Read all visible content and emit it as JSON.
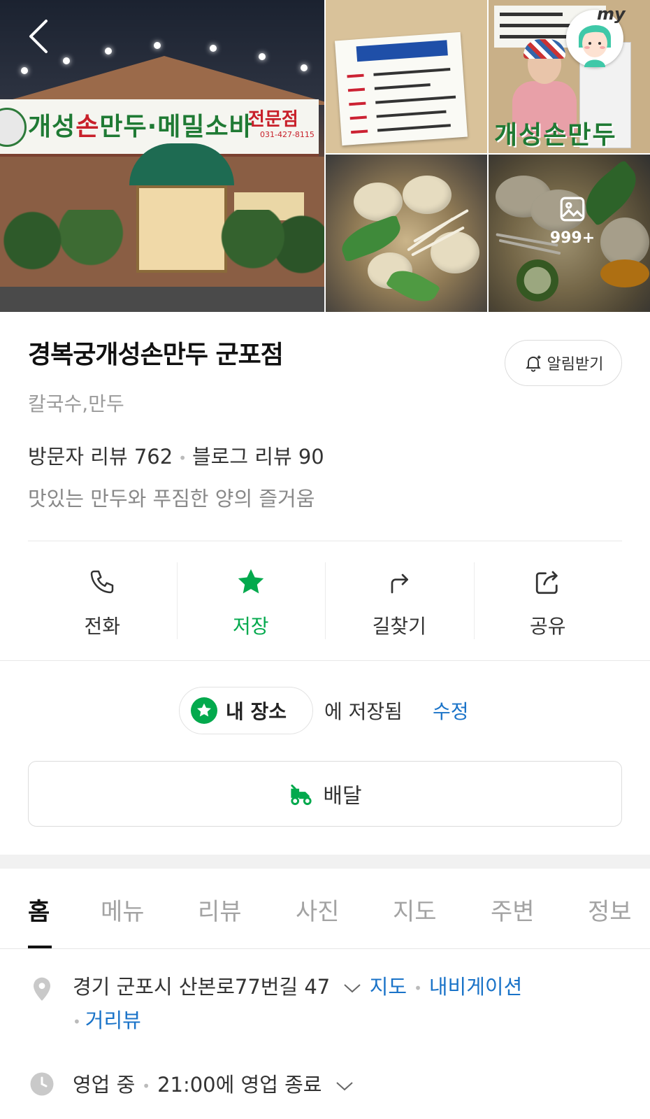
{
  "gallery": {
    "main_sign_text_green_1": "개성",
    "main_sign_text_red_1": "손",
    "main_sign_text_green_2": "만두·메밀소바",
    "main_sign_sub": "전문점",
    "main_sign_phone": "031-427-8115",
    "cook_photo_sign": "개성손만두",
    "photo_count": "999+",
    "my_badge": "my"
  },
  "place": {
    "title": "경복궁개성손만두 군포점",
    "alarm_label": "알림받기",
    "category": "칼국수,만두",
    "visitor_review_label": "방문자 리뷰 762",
    "blog_review_label": "블로그 리뷰 90",
    "description": "맛있는 만두와 푸짐한 양의 즐거움"
  },
  "actions": [
    {
      "label": "전화",
      "icon": "phone-icon"
    },
    {
      "label": "저장",
      "icon": "star-icon"
    },
    {
      "label": "길찾기",
      "icon": "directions-icon"
    },
    {
      "label": "공유",
      "icon": "share-icon"
    }
  ],
  "saved": {
    "list_name": "내 장소",
    "saved_text": "에 저장됨",
    "edit_label": "수정"
  },
  "delivery": {
    "label": "배달"
  },
  "tabs": [
    "홈",
    "메뉴",
    "리뷰",
    "사진",
    "지도",
    "주변",
    "정보"
  ],
  "address": {
    "text": "경기 군포시 산본로77번길 47",
    "map_link": "지도",
    "navigation_link": "내비게이션",
    "street_view_link": "거리뷰"
  },
  "hours": {
    "status": "영업 중",
    "close_text": "21:00에 영업 종료"
  },
  "colors": {
    "accent_green": "#03a94d",
    "link_blue": "#1a73c8"
  }
}
